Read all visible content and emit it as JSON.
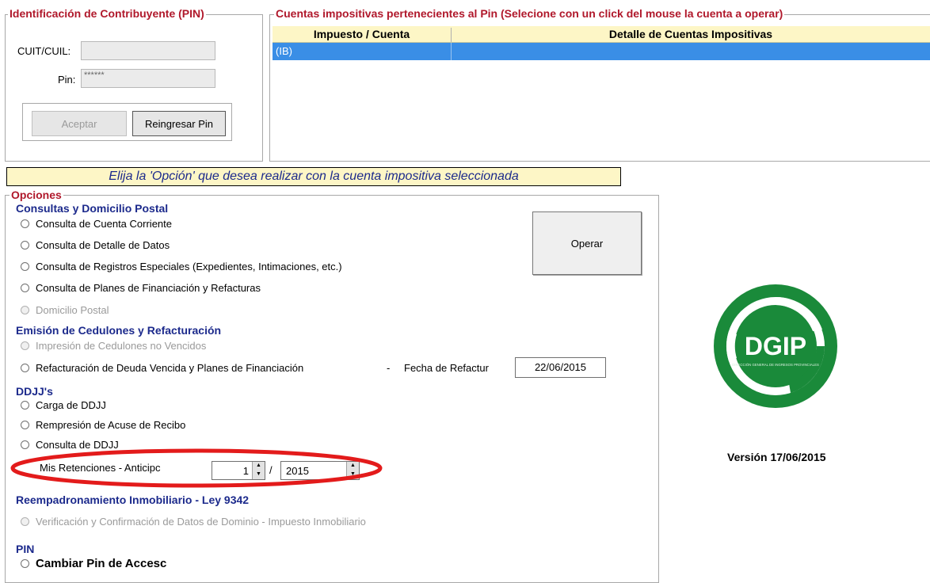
{
  "pin_section": {
    "legend": "Identificación de Contribuyente (PIN)",
    "cuit_label": "CUIT/CUIL:",
    "cuit_value": "",
    "pin_label": "Pin:",
    "pin_value": "******",
    "accept_button": "Aceptar",
    "reenter_button": "Reingresar Pin"
  },
  "accounts_section": {
    "legend": "Cuentas impositivas pertenecientes al Pin (Selecione con un click del mouse la cuenta a operar)",
    "columns": [
      "Impuesto / Cuenta",
      "Detalle de Cuentas Impositivas"
    ],
    "rows": [
      {
        "account": "(IB)",
        "detail": ""
      }
    ]
  },
  "instruction": "Elija la 'Opción' que desea realizar con la cuenta impositiva seleccionada",
  "options": {
    "legend": "Opciones",
    "operate_button": "Operar",
    "consultas": {
      "title": "Consultas y Domicilio Postal",
      "items": [
        "Consulta de Cuenta Corriente",
        "Consulta de Detalle de Datos",
        "Consulta de Registros Especiales (Expedientes, Intimaciones, etc.)",
        "Consulta de Planes de Financiación y Refacturas",
        "Domicilio Postal"
      ]
    },
    "emision": {
      "title": "Emisión de Cedulones y Refacturación",
      "items": [
        "Impresión de Cedulones no Vencidos",
        "Refacturación de Deuda Vencida y Planes de Financiación"
      ],
      "date_separator": "-",
      "date_label": "Fecha de Refactur",
      "date_value": "22/06/2015"
    },
    "ddjj": {
      "title": "DDJJ's",
      "items": [
        "Carga de DDJJ",
        "Rempresión de Acuse de Recibo",
        "Consulta de DDJJ"
      ],
      "retenciones_label": "Mis Retenciones  -  Anticipc",
      "anticipo_value": "1",
      "slash": "/",
      "year_value": "2015"
    },
    "reempadronamiento": {
      "title": "Reempadronamiento Inmobiliario - Ley 9342",
      "items": [
        "Verificación y Confirmación de Datos de Dominio - Impuesto Inmobiliario"
      ]
    },
    "pin": {
      "title": "PIN",
      "items": [
        "Cambiar Pin de Accesc"
      ]
    }
  },
  "logo": {
    "text": "DGIP",
    "subtext": "DIRECCIÓN GENERAL DE INGRESOS PROVINCIALES",
    "color": "#1a8a3a"
  },
  "version": "Versión 17/06/2015",
  "colors": {
    "selection": "#3a8ee6",
    "header_bg": "#fdf6c6",
    "legend_red": "#b0182b",
    "section_navy": "#1c2a8c",
    "annotation_red": "#e31b1b"
  }
}
